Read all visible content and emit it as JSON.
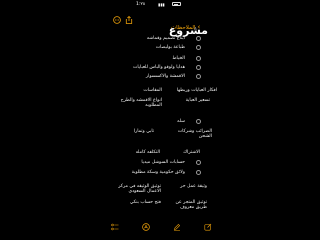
{
  "status": {
    "time": "1:٢٨"
  },
  "nav": {
    "back_label": "الملاحظات"
  },
  "note": {
    "title": "مشروع",
    "checklist_top": [
      "ابتاع تصميم وقماشه",
      "طباعة بوليصات",
      "الخياط",
      "هدايا ولوقو والباس للعبايات",
      "الاقمشة والاكسسوار"
    ],
    "table_rows": [
      {
        "right": "المقاسات",
        "left": "افكار العبايات وربطها"
      },
      {
        "right": "تسعير العباية",
        "left": "انواع الاقمشه والطرح المطلوبه"
      }
    ],
    "checklist_mid": [
      "سله"
    ],
    "table2_rows": [
      {
        "right": "الضرائب وشركات الشحن",
        "left": "تابي وتمارا"
      },
      {
        "right": "الاشتراك",
        "left": "التكلفه كامله"
      }
    ],
    "checklist_bottom": [
      "حسابات السوشل ميديا",
      "ولائق حكومية وسكة مطلوبة"
    ],
    "table3_rows": [
      {
        "right": "وثيقة عمل حر",
        "left": "توثيق الوثيقه في مركز الاعمال السعودي"
      },
      {
        "right": "توثيق المتجر عن طريق معروف",
        "left": "فتح حساب بنكي"
      }
    ]
  },
  "toolbar": {
    "checklist_icon": "checklist-icon",
    "camera_icon": "camera-icon",
    "markup_icon": "markup-pen-icon",
    "compose_icon": "compose-icon"
  }
}
